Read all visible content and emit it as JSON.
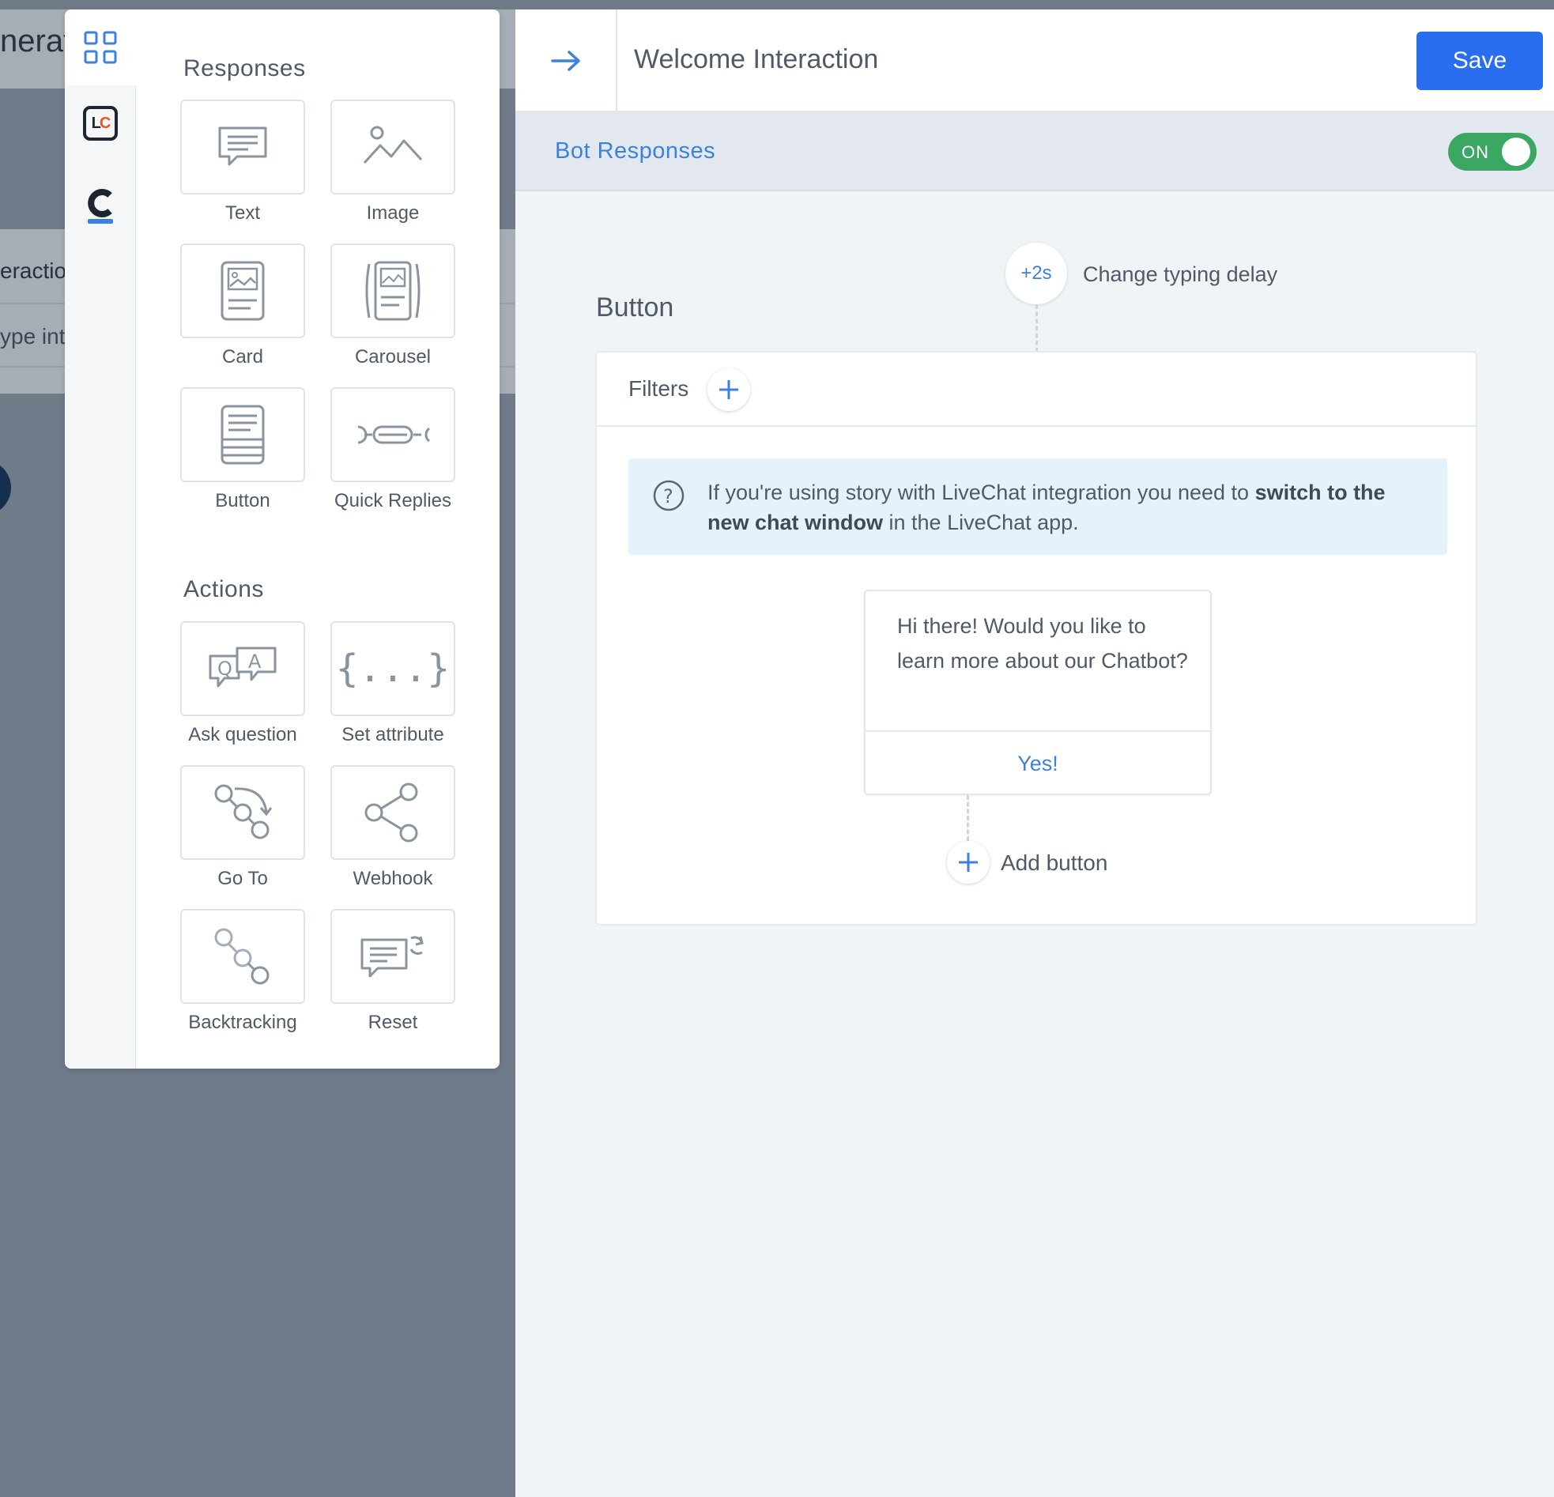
{
  "background": {
    "title_fragment": "nerat",
    "row_fragment": "eractio",
    "input_fragment": "ype int"
  },
  "palette": {
    "rail": [
      {
        "icon": "grid-icon",
        "active": true
      },
      {
        "icon": "livechat-logo",
        "text": "LC"
      },
      {
        "icon": "chatbot-logo"
      }
    ],
    "responses_title": "Responses",
    "responses": [
      {
        "label": "Text",
        "icon": "text-message-icon"
      },
      {
        "label": "Image",
        "icon": "image-icon"
      },
      {
        "label": "Card",
        "icon": "card-icon"
      },
      {
        "label": "Carousel",
        "icon": "carousel-icon"
      },
      {
        "label": "Button",
        "icon": "button-icon"
      },
      {
        "label": "Quick Replies",
        "icon": "quick-replies-icon"
      }
    ],
    "actions_title": "Actions",
    "actions": [
      {
        "label": "Ask question",
        "icon": "ask-question-icon"
      },
      {
        "label": "Set attribute",
        "icon": "set-attribute-icon",
        "glyph": "{...}"
      },
      {
        "label": "Go To",
        "icon": "go-to-icon"
      },
      {
        "label": "Webhook",
        "icon": "webhook-icon"
      },
      {
        "label": "Backtracking",
        "icon": "backtracking-icon"
      },
      {
        "label": "Reset",
        "icon": "reset-icon"
      }
    ]
  },
  "editor": {
    "title": "Welcome Interaction",
    "save_label": "Save",
    "subbar_title": "Bot Responses",
    "toggle_label": "ON",
    "delay_badge": "+2s",
    "delay_label": "Change typing delay",
    "block_title": "Button",
    "filters_label": "Filters",
    "info": {
      "part1": "If you're using story with LiveChat integration you need to ",
      "bold": "switch to the new chat window",
      "part2": " in the LiveChat app."
    },
    "message_text": "Hi there! Would you like to learn more about our Chatbot?",
    "button_label": "Yes!",
    "add_button_label": "Add button"
  },
  "colors": {
    "accent": "#2a6ef0",
    "link": "#3b82e0",
    "toggle_on": "#3aa862",
    "info_bg": "#e4f2fc"
  }
}
